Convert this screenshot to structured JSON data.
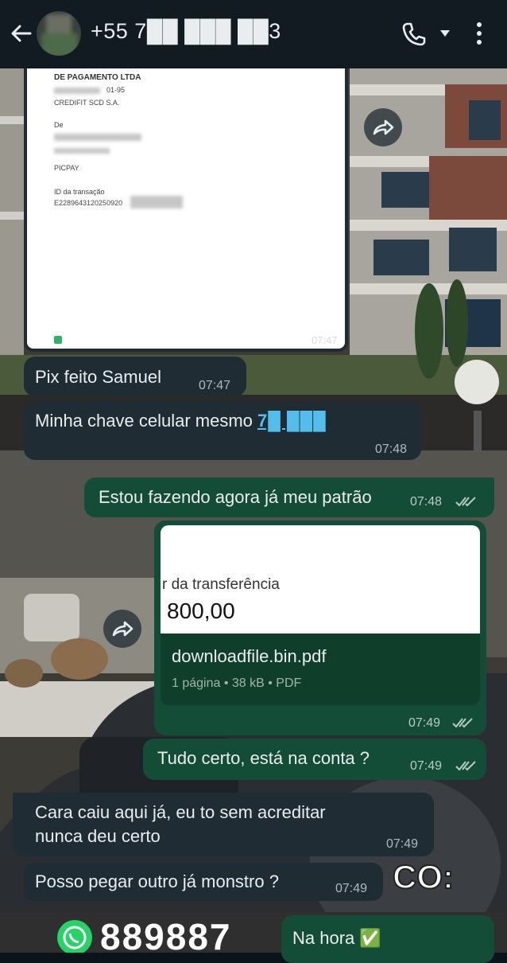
{
  "header": {
    "contact_name": "+55 7██ ███ ██3"
  },
  "receipt": {
    "line1": "DE PAGAMENTO LTDA",
    "line2": "01-95",
    "line3": "CREDIFIT SCD S.A.",
    "from_label": "De",
    "bank": "PICPAY",
    "txid_label": "ID da transação",
    "txid_value": "E2289643120250920",
    "time": "07:47"
  },
  "messages": [
    {
      "dir": "in",
      "text": "Pix feito Samuel",
      "time": "07:47"
    },
    {
      "dir": "in",
      "text": "Minha chave celular mesmo ",
      "link": "7█ ███",
      "time": "07:48"
    },
    {
      "dir": "out",
      "text": "Estou fazendo agora já meu patrão",
      "time": "07:48"
    },
    {
      "dir": "out",
      "preview_label": "r da transferência",
      "preview_amount": "800,00",
      "file_name": "downloadfile.bin.pdf",
      "file_meta": "1 página • 38 kB • PDF",
      "time": "07:49"
    },
    {
      "dir": "out",
      "text": "Tudo certo, está na conta ?",
      "time": "07:49"
    },
    {
      "dir": "in",
      "text_line1": "Cara caiu aqui já, eu to sem acreditar",
      "text_line2": "nunca deu certo",
      "time": "07:49"
    },
    {
      "dir": "in",
      "text": "Posso pegar outro já monstro ?",
      "time": "07:49"
    },
    {
      "dir": "out",
      "text": "Na hora ✅"
    }
  ],
  "wallpaper": {
    "sign_text": "CO:",
    "phone_text": "889887"
  },
  "colors": {
    "header_bg": "#111b21",
    "incoming_bubble": "#202c33",
    "outgoing_bubble": "#144d37",
    "accent_link": "#53bdeb",
    "read_ticks": "#b6ccc1"
  }
}
